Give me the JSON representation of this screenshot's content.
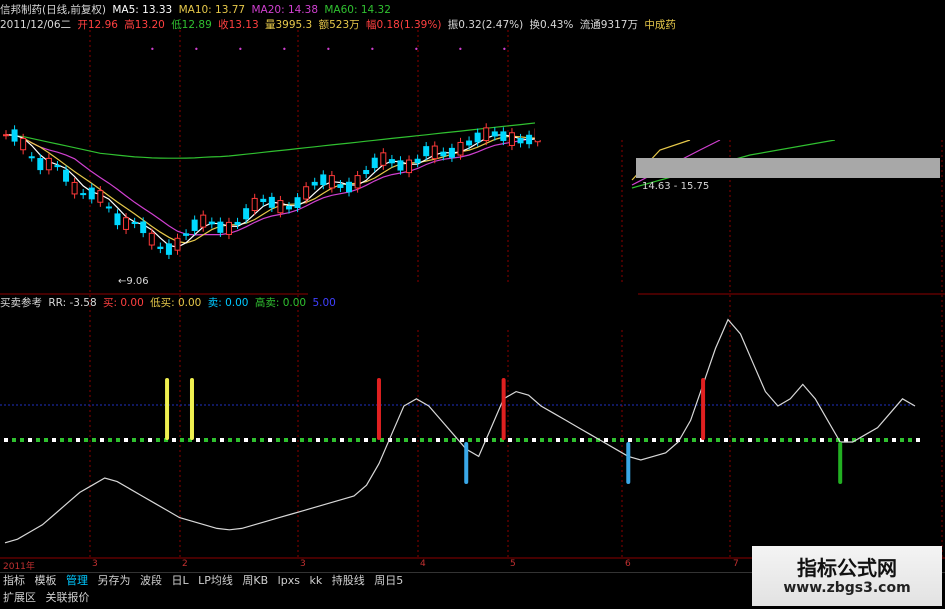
{
  "header": {
    "title": "信邦制药(日线,前复权)",
    "ma5": "MA5: 13.33",
    "ma10": "MA10: 13.77",
    "ma20": "MA20: 14.38",
    "ma60": "MA60: 14.32",
    "date": "2011/12/06二",
    "open": "开12.96",
    "high": "高13.20",
    "low": "低12.89",
    "close": "收13.13",
    "volume": "量3995.3",
    "amount": "额523万",
    "change": "幅0.18(1.39%)",
    "amplitude": "振0.32(2.47%)",
    "turnover": "换0.43%",
    "float": "流通9317万",
    "sector": "中成药"
  },
  "main_chart": {
    "low_label": "←9.06",
    "range_label": "14.63 - 15.75"
  },
  "sub_header": {
    "title": "买卖参考",
    "rr": "RR: -3.58",
    "buy": "买: 0.00",
    "low_buy": "低买: 0.00",
    "sell": "卖: 0.00",
    "high_sell": "高卖: 0.00",
    "extra": "5.00"
  },
  "time_axis": [
    "2011年",
    "3",
    "2",
    "3",
    "4",
    "5",
    "6",
    "7"
  ],
  "toolbar": [
    "指标",
    "模板",
    "管理",
    "另存为",
    "波段",
    "日L",
    "LP均线",
    "周KB",
    "lpxs",
    "kk",
    "持股线",
    "周日5"
  ],
  "toolbar_active_index": 2,
  "bottom_tabs": [
    "扩展区",
    "关联报价"
  ],
  "watermark": {
    "title": "指标公式网",
    "url": "www.zbgs3.com"
  },
  "colors": {
    "up": "#ff3a3a",
    "down": "#00d8ff",
    "ma5": "#ffffff",
    "ma10": "#e6c84a",
    "ma20": "#d040d0",
    "ma60": "#30c030",
    "grid": "#8b0000",
    "yellow": "#f0f050",
    "red_signal": "#e02020",
    "blue_signal": "#3aa8e8",
    "green_signal": "#22b022"
  },
  "chart_data": {
    "type": "candlestick",
    "ma60": [
      15.5,
      15.45,
      15.4,
      15.3,
      15.2,
      15.1,
      15.0,
      14.9,
      14.8,
      14.7,
      14.6,
      14.5,
      14.45,
      14.4,
      14.35,
      14.3,
      14.28,
      14.25,
      14.24,
      14.23,
      14.23,
      14.24,
      14.25,
      14.28,
      14.3,
      14.32,
      14.35,
      14.4,
      14.45,
      14.5,
      14.55,
      14.6,
      14.65,
      14.7,
      14.75,
      14.8,
      14.85,
      14.9,
      14.95,
      15.0,
      15.05,
      15.1,
      15.15,
      15.2,
      15.25,
      15.3,
      15.35,
      15.4,
      15.45,
      15.5,
      15.55,
      15.6,
      15.65,
      15.7,
      15.75,
      15.8,
      15.85,
      15.9,
      15.95,
      16.0,
      16.05,
      16.1,
      16.15,
      16.2,
      16.3,
      16.4,
      16.5,
      16.6,
      16.7,
      16.8,
      16.9,
      17.0,
      17.1,
      17.2
    ],
    "signal_line": [
      0.1,
      0.15,
      0.25,
      0.35,
      0.5,
      0.65,
      0.8,
      0.9,
      1.0,
      0.95,
      0.85,
      0.75,
      0.65,
      0.55,
      0.45,
      0.4,
      0.35,
      0.3,
      0.28,
      0.3,
      0.35,
      0.4,
      0.45,
      0.5,
      0.55,
      0.6,
      0.65,
      0.7,
      0.75,
      0.9,
      1.2,
      1.6,
      2.0,
      2.1,
      2.0,
      1.8,
      1.6,
      1.4,
      1.3,
      1.7,
      2.1,
      2.2,
      2.15,
      2.0,
      1.9,
      1.8,
      1.7,
      1.6,
      1.5,
      1.4,
      1.3,
      1.25,
      1.3,
      1.35,
      1.5,
      1.8,
      2.3,
      2.8,
      3.2,
      3.0,
      2.6,
      2.2,
      2.0,
      2.1,
      2.3,
      2.1,
      1.8,
      1.5,
      1.5,
      1.6,
      1.7,
      1.9,
      2.1,
      2.0
    ],
    "yellow_signals": [
      13,
      15
    ],
    "red_signals": [
      30,
      40,
      56
    ],
    "blue_signals": [
      37,
      50
    ],
    "green_signals": [
      67
    ]
  }
}
